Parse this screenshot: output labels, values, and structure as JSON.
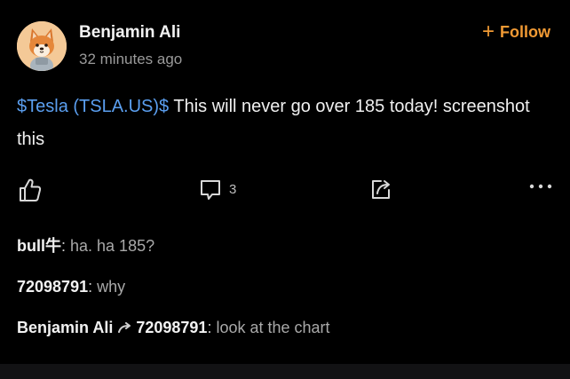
{
  "post": {
    "author": "Benjamin Ali",
    "time": "32 minutes ago",
    "follow_label": "Follow",
    "follow_icon": "plus-icon",
    "ticker_link": "$Tesla (TSLA.US)$",
    "text": " This will never go over 185 today! screenshot this",
    "avatar_icon": "shiba-dog-avatar",
    "accent_color": "#f19a34",
    "link_color": "#5b9ff0"
  },
  "actions": {
    "like_icon": "thumbs-up-icon",
    "comment_icon": "comment-icon",
    "comment_count": "3",
    "share_icon": "share-icon",
    "more_icon": "more-dots-icon"
  },
  "comments": [
    {
      "user": "bull牛",
      "text": "ha. ha 185?"
    },
    {
      "user": "72098791",
      "text": "why"
    },
    {
      "user": "Benjamin Ali",
      "reply_to": "72098791",
      "text": "look at the chart"
    }
  ]
}
